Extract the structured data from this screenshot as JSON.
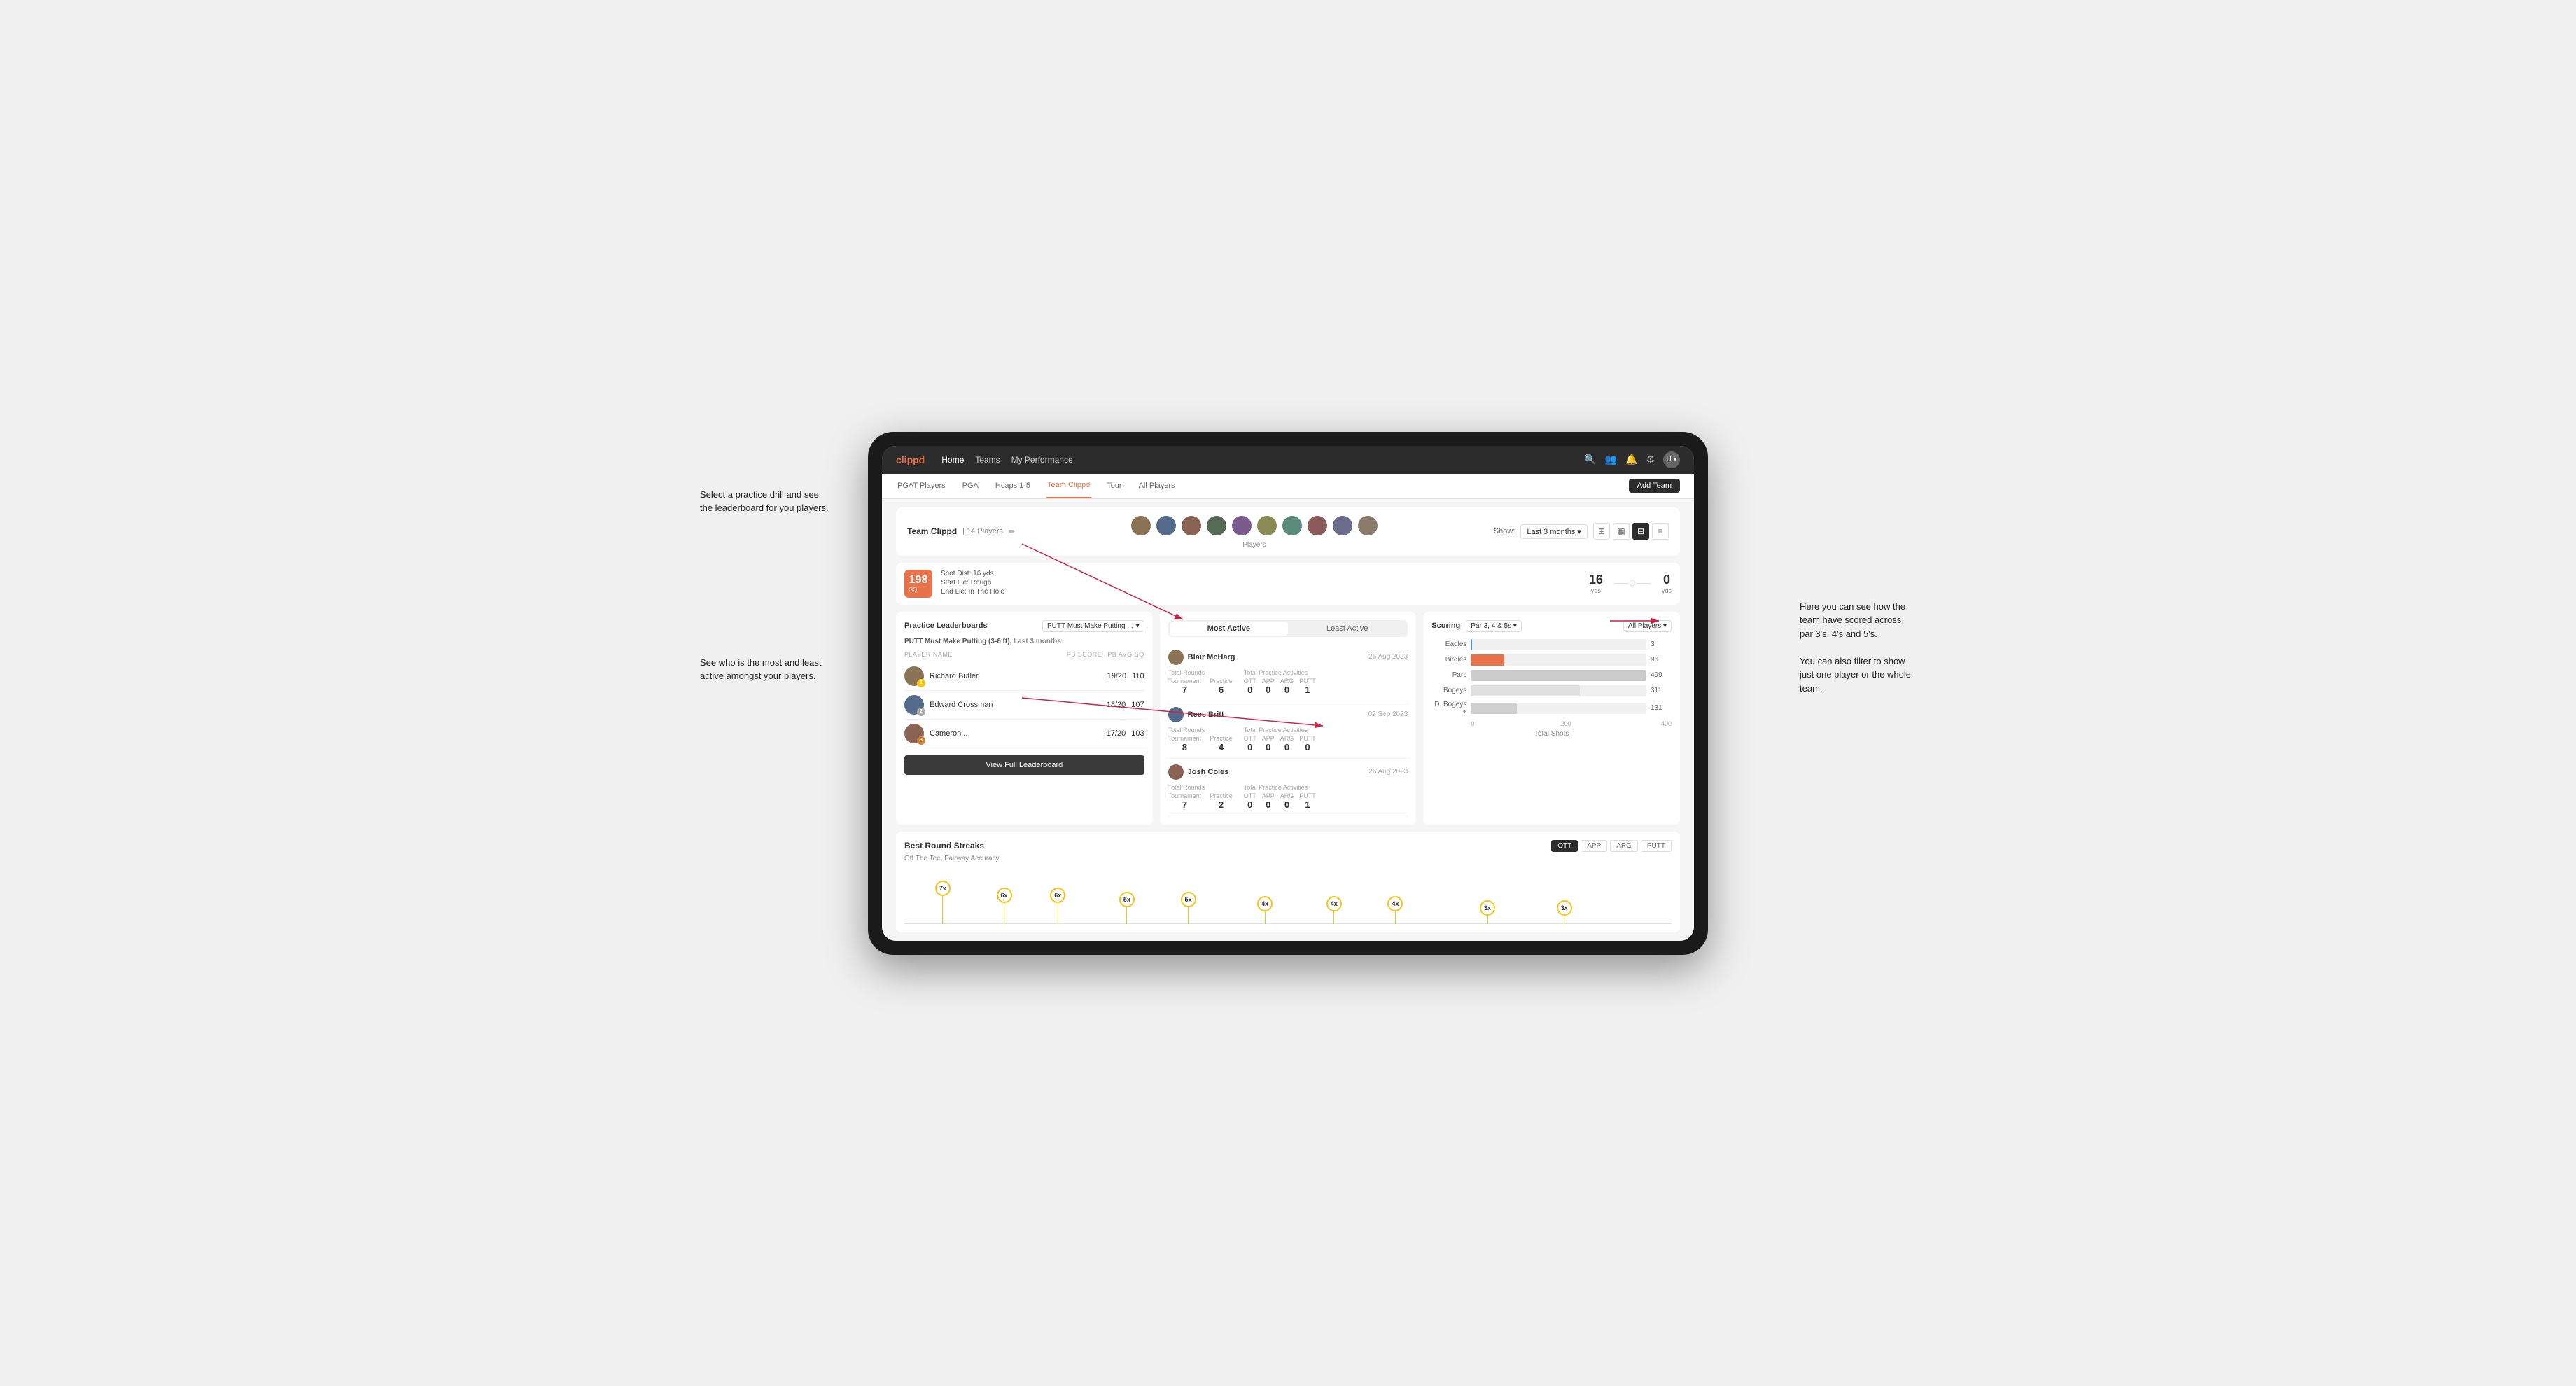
{
  "annotations": {
    "top_left": "Select a practice drill and see\nthe leaderboard for you players.",
    "bottom_left": "See who is the most and least\nactive amongst your players.",
    "top_right": "Here you can see how the\nteam have scored across\npar 3's, 4's and 5's.\n\nYou can also filter to show\njust one player or the whole\nteam."
  },
  "nav": {
    "logo": "clippd",
    "links": [
      "Home",
      "Teams",
      "My Performance"
    ],
    "icons": [
      "search",
      "people",
      "bell",
      "settings",
      "avatar"
    ]
  },
  "sub_nav": {
    "links": [
      "PGAT Players",
      "PGA",
      "Hcaps 1-5",
      "Team Clippd",
      "Tour",
      "All Players"
    ],
    "active": "Team Clippd",
    "add_team_label": "Add Team"
  },
  "team_header": {
    "name": "Team Clippd",
    "count": "14 Players",
    "show_label": "Show:",
    "show_value": "Last 3 months",
    "player_avatars_count": 10,
    "players_label": "Players"
  },
  "shot_card": {
    "badge": "198",
    "badge_sub": "SQ",
    "details": [
      "Shot Dist: 16 yds",
      "Start Lie: Rough",
      "End Lie: In The Hole"
    ],
    "meter1_value": "16",
    "meter1_unit": "yds",
    "meter2_value": "0",
    "meter2_unit": "yds"
  },
  "practice_leaderboard": {
    "title": "Practice Leaderboards",
    "dropdown": "PUTT Must Make Putting ...",
    "subtitle_drill": "PUTT Must Make Putting (3-6 ft),",
    "subtitle_period": "Last 3 months",
    "col_player": "PLAYER NAME",
    "col_score": "PB SCORE",
    "col_avg": "PB AVG SQ",
    "players": [
      {
        "name": "Richard Butler",
        "score": "19/20",
        "avg": "110",
        "badge": "gold",
        "num": "1"
      },
      {
        "name": "Edward Crossman",
        "score": "18/20",
        "avg": "107",
        "badge": "silver",
        "num": "2"
      },
      {
        "name": "Cameron...",
        "score": "17/20",
        "avg": "103",
        "badge": "bronze",
        "num": "3"
      }
    ],
    "view_label": "View Full Leaderboard"
  },
  "activity": {
    "tabs": [
      "Most Active",
      "Least Active"
    ],
    "active_tab": "Most Active",
    "players": [
      {
        "name": "Blair McHarg",
        "date": "26 Aug 2023",
        "total_rounds_label": "Total Rounds",
        "tournament_label": "Tournament",
        "practice_label": "Practice",
        "tournament_value": "7",
        "practice_value": "6",
        "practice_activities_label": "Total Practice Activities",
        "ott": "0",
        "app": "0",
        "arg": "0",
        "putt": "1"
      },
      {
        "name": "Rees Britt",
        "date": "02 Sep 2023",
        "total_rounds_label": "Total Rounds",
        "tournament_label": "Tournament",
        "practice_label": "Practice",
        "tournament_value": "8",
        "practice_value": "4",
        "practice_activities_label": "Total Practice Activities",
        "ott": "0",
        "app": "0",
        "arg": "0",
        "putt": "0"
      },
      {
        "name": "Josh Coles",
        "date": "26 Aug 2023",
        "total_rounds_label": "Total Rounds",
        "tournament_label": "Tournament",
        "practice_label": "Practice",
        "tournament_value": "7",
        "practice_value": "2",
        "practice_activities_label": "Total Practice Activities",
        "ott": "0",
        "app": "0",
        "arg": "0",
        "putt": "1"
      }
    ]
  },
  "scoring": {
    "title": "Scoring",
    "par_filter": "Par 3, 4 & 5s",
    "player_filter": "All Players",
    "bars": [
      {
        "label": "Eagles",
        "value": 3,
        "max": 500,
        "color": "eagles"
      },
      {
        "label": "Birdies",
        "value": 96,
        "max": 500,
        "color": "birdies"
      },
      {
        "label": "Pars",
        "value": 499,
        "max": 500,
        "color": "pars"
      },
      {
        "label": "Bogeys",
        "value": 311,
        "max": 500,
        "color": "bogeys"
      },
      {
        "label": "D.Bogeys +",
        "value": 131,
        "max": 500,
        "color": "dbogeys"
      }
    ],
    "axis_values": [
      "0",
      "200",
      "400"
    ],
    "axis_title": "Total Shots"
  },
  "streaks": {
    "title": "Best Round Streaks",
    "subtitle": "Off The Tee, Fairway Accuracy",
    "filters": [
      "OTT",
      "APP",
      "ARG",
      "PUTT"
    ],
    "active_filter": "OTT",
    "points": [
      {
        "label": "7x",
        "pos": 5
      },
      {
        "label": "6x",
        "pos": 15
      },
      {
        "label": "6x",
        "pos": 22
      },
      {
        "label": "5x",
        "pos": 32
      },
      {
        "label": "5x",
        "pos": 40
      },
      {
        "label": "4x",
        "pos": 52
      },
      {
        "label": "4x",
        "pos": 60
      },
      {
        "label": "4x",
        "pos": 68
      },
      {
        "label": "3x",
        "pos": 80
      },
      {
        "label": "3x",
        "pos": 88
      }
    ]
  }
}
